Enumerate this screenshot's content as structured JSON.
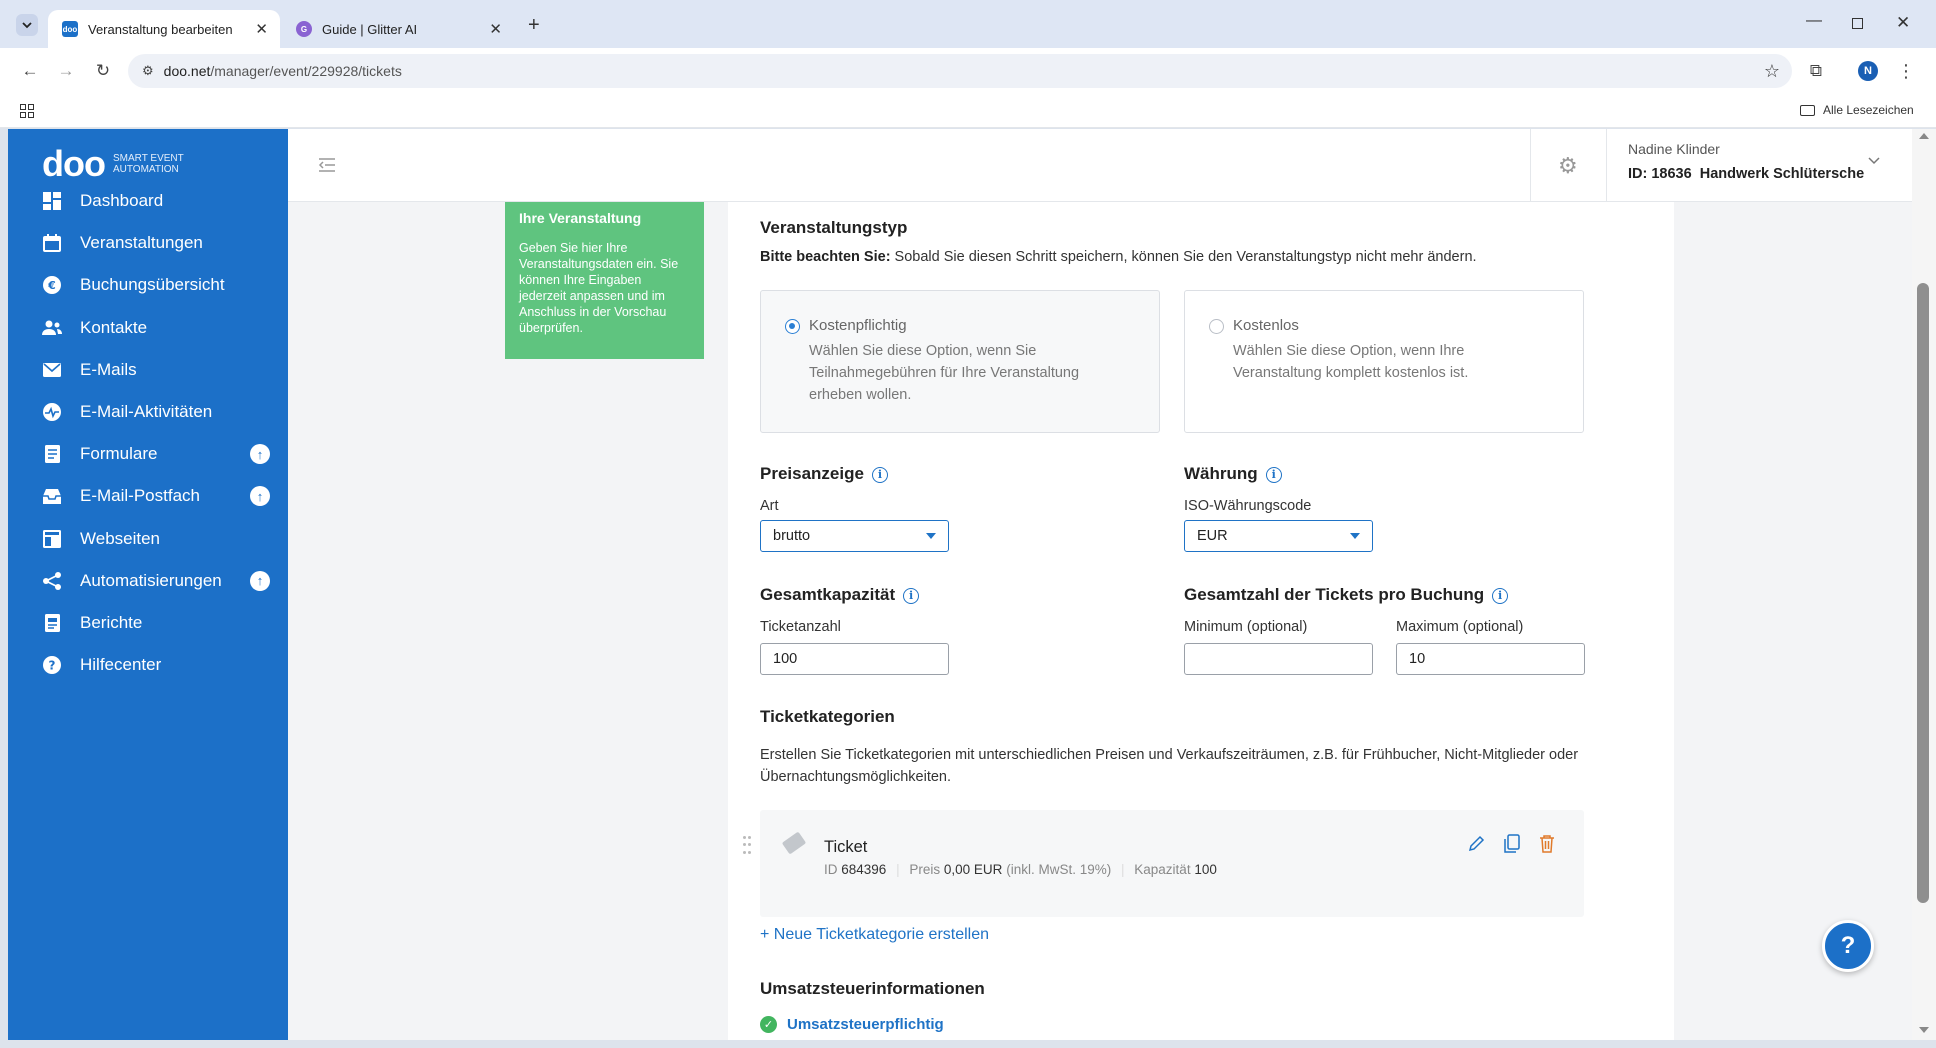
{
  "browser": {
    "tabs": [
      {
        "label": "Veranstaltung bearbeiten",
        "active": true
      },
      {
        "label": "Guide | Glitter AI",
        "active": false
      }
    ],
    "url_host": "doo.net",
    "url_path": "/manager/event/229928/tickets",
    "profile_initial": "N",
    "bookmarks_label": "Alle Lesezeichen"
  },
  "brand": {
    "logo": "doo",
    "tagline_1": "SMART EVENT",
    "tagline_2": "AUTOMATION",
    "accent": "#1c70c8"
  },
  "sidebar": {
    "items": [
      {
        "label": "Dashboard",
        "icon": "dashboard-icon",
        "badge": false
      },
      {
        "label": "Veranstaltungen",
        "icon": "calendar-icon",
        "badge": false
      },
      {
        "label": "Buchungsübersicht",
        "icon": "euro-icon",
        "badge": false
      },
      {
        "label": "Kontakte",
        "icon": "contacts-icon",
        "badge": false
      },
      {
        "label": "E-Mails",
        "icon": "mail-icon",
        "badge": false
      },
      {
        "label": "E-Mail-Aktivitäten",
        "icon": "activity-icon",
        "badge": false
      },
      {
        "label": "Formulare",
        "icon": "form-icon",
        "badge": true
      },
      {
        "label": "E-Mail-Postfach",
        "icon": "inbox-icon",
        "badge": true
      },
      {
        "label": "Webseiten",
        "icon": "website-icon",
        "badge": false
      },
      {
        "label": "Automatisierungen",
        "icon": "share-icon",
        "badge": true
      },
      {
        "label": "Berichte",
        "icon": "report-icon",
        "badge": false
      },
      {
        "label": "Hilfecenter",
        "icon": "help-icon",
        "badge": false
      }
    ]
  },
  "user": {
    "name": "Nadine Klinder",
    "org": "ID: 18636  Handwerk Schlütersche"
  },
  "hint": {
    "title": "Ihre Veranstaltung",
    "text": "Geben Sie hier Ihre Veranstaltungsdaten ein. Sie können Ihre Eingaben jederzeit anpassen und im Anschluss in der Vorschau überprüfen.",
    "color": "#5fc47f"
  },
  "form": {
    "event_type": {
      "title": "Veranstaltungstyp",
      "note_bold": "Bitte beachten Sie:",
      "note": " Sobald Sie diesen Schritt speichern, können Sie den Veranstaltungstyp nicht mehr ändern.",
      "options": [
        {
          "label": "Kostenpflichtig",
          "desc": "Wählen Sie diese Option, wenn Sie Teilnahmegebühren für Ihre Veranstaltung erheben wollen.",
          "selected": true
        },
        {
          "label": "Kostenlos",
          "desc": "Wählen Sie diese Option, wenn Ihre Veranstaltung komplett kostenlos ist.",
          "selected": false
        }
      ]
    },
    "price_display": {
      "title": "Preisanzeige",
      "label": "Art",
      "value": "brutto"
    },
    "currency": {
      "title": "Währung",
      "label": "ISO-Währungscode",
      "value": "EUR"
    },
    "capacity": {
      "title": "Gesamtkapazität",
      "label": "Ticketanzahl",
      "value": "100"
    },
    "tickets_per_booking": {
      "title": "Gesamtzahl der Tickets pro Buchung",
      "min_label": "Minimum (optional)",
      "min_value": "",
      "max_label": "Maximum (optional)",
      "max_value": "10"
    },
    "ticket_categories": {
      "title": "Ticketkategorien",
      "desc": "Erstellen Sie Ticketkategorien mit unterschiedlichen Preisen und Verkaufszeiträumen, z.B. für Frühbucher, Nicht-Mitglieder oder Übernachtungsmöglichkeiten.",
      "ticket": {
        "name": "Ticket",
        "id_label": "ID",
        "id": "684396",
        "price_label": "Preis",
        "price": "0,00 EUR",
        "price_note": "(inkl. MwSt. 19%)",
        "capacity_label": "Kapazität",
        "capacity": "100"
      },
      "add_link": "+ Neue Ticketkategorie erstellen"
    },
    "tax": {
      "title": "Umsatzsteuerinformationen",
      "status": "Umsatzsteuerpflichtig"
    }
  },
  "help_button": "?"
}
